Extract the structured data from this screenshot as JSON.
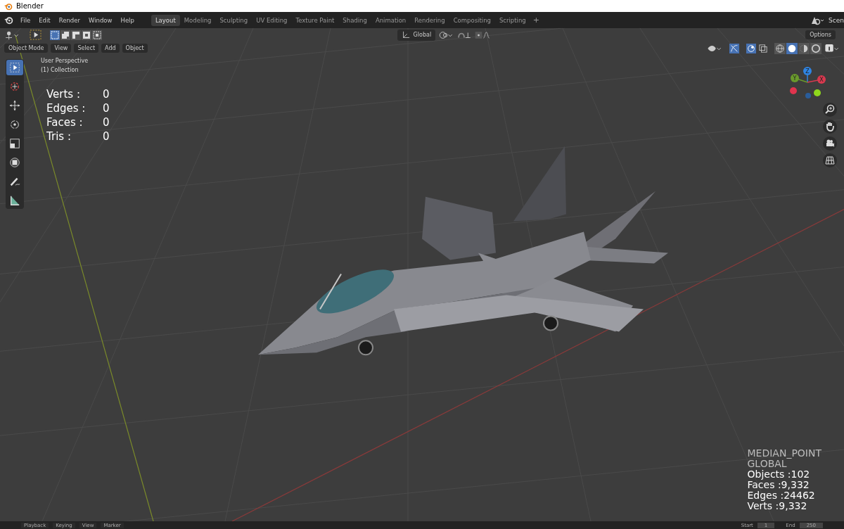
{
  "window": {
    "title": "Blender"
  },
  "menu": [
    "File",
    "Edit",
    "Render",
    "Window",
    "Help"
  ],
  "workspaces": [
    {
      "label": "Layout",
      "selected": true
    },
    {
      "label": "Modeling",
      "selected": false
    },
    {
      "label": "Sculpting",
      "selected": false
    },
    {
      "label": "UV Editing",
      "selected": false
    },
    {
      "label": "Texture Paint",
      "selected": false
    },
    {
      "label": "Shading",
      "selected": false
    },
    {
      "label": "Animation",
      "selected": false
    },
    {
      "label": "Rendering",
      "selected": false
    },
    {
      "label": "Compositing",
      "selected": false
    },
    {
      "label": "Scripting",
      "selected": false
    }
  ],
  "add_workspace": "+",
  "scene": {
    "label": "Scen"
  },
  "header": {
    "orientation": "Global",
    "options": "Options"
  },
  "selection_modes": [
    {
      "kind": "new",
      "selected": true
    },
    {
      "kind": "extend",
      "selected": false
    },
    {
      "kind": "subtract",
      "selected": false
    },
    {
      "kind": "invert",
      "selected": false
    },
    {
      "kind": "intersect",
      "selected": false
    }
  ],
  "mode": {
    "label": "Object Mode"
  },
  "view_menu": [
    "View",
    "Select",
    "Add",
    "Object"
  ],
  "shading": [
    {
      "kind": "wireframe",
      "selected": false
    },
    {
      "kind": "solid",
      "selected": true
    },
    {
      "kind": "material",
      "selected": false
    },
    {
      "kind": "rendered",
      "selected": false
    }
  ],
  "tools": [
    {
      "kind": "select",
      "selected": true
    },
    {
      "kind": "cursor",
      "selected": false
    },
    {
      "kind": "move",
      "selected": false
    },
    {
      "kind": "rotate",
      "selected": false
    },
    {
      "kind": "scale",
      "selected": false
    },
    {
      "kind": "transform",
      "selected": false
    },
    {
      "kind": "annotate",
      "selected": false
    },
    {
      "kind": "measure",
      "selected": false
    }
  ],
  "overlay": {
    "view": "User Perspective",
    "collection": "(1) Collection"
  },
  "stats": [
    {
      "label": "Verts :",
      "value": "0"
    },
    {
      "label": "Edges :",
      "value": "0"
    },
    {
      "label": "Faces :",
      "value": "0"
    },
    {
      "label": "Tris :",
      "value": "0"
    }
  ],
  "gizmo": [
    {
      "label": "Z",
      "color": "#2f84e3"
    },
    {
      "label": "Y",
      "color": "#6a9a2c"
    },
    {
      "label": "X",
      "color": "#d8394f"
    }
  ],
  "info": [
    "MEDIAN_POINT",
    "GLOBAL",
    "Objects :102",
    "Faces :9,332",
    "Edges :24462",
    "Verts :9,332"
  ],
  "timeline": {
    "menus": [
      "Playback",
      "Keying",
      "View",
      "Marker"
    ],
    "start_label": "Start",
    "start": "1",
    "end_label": "End",
    "end": "250"
  }
}
